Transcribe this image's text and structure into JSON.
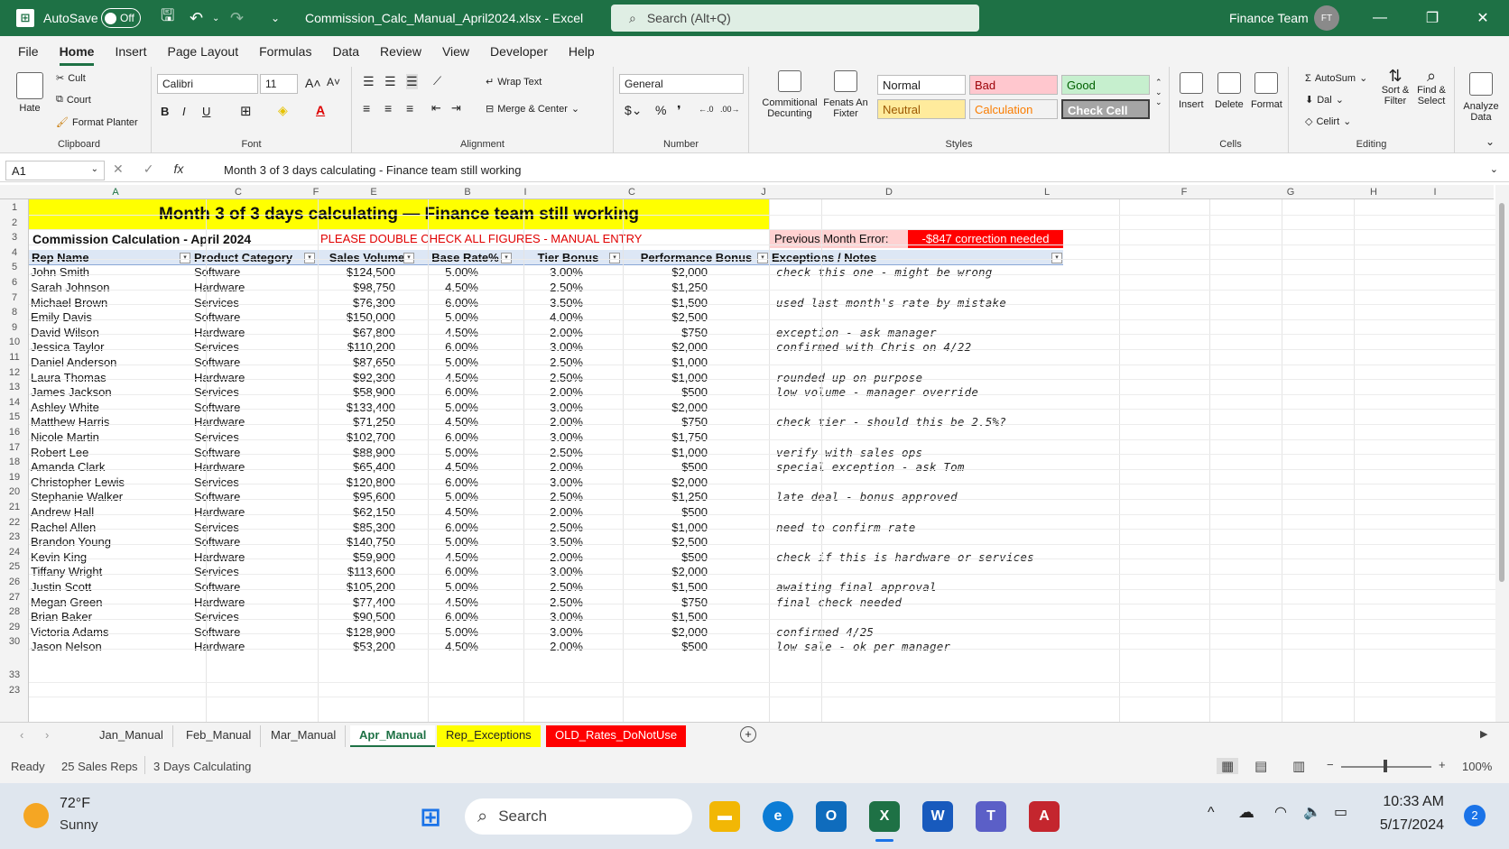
{
  "titlebar": {
    "autosave_label": "AutoSave",
    "autosave_state": "Off",
    "filename": "Commission_Calc_Manual_April2024.xlsx",
    "app": "Excel",
    "search_placeholder": "Search (Alt+Q)",
    "user": "Finance Team",
    "user_initials": "FT"
  },
  "menu": [
    "File",
    "Home",
    "Insert",
    "Page Layout",
    "Formulas",
    "Data",
    "Review",
    "View",
    "Developer",
    "Help"
  ],
  "ribbon": {
    "clipboard": {
      "paste": "Hate",
      "cut": "Cult",
      "copy": "Court",
      "format_painter": "Format Planter",
      "label": "Clipboard"
    },
    "font": {
      "name": "Calibri",
      "size": "11",
      "label": "Font"
    },
    "alignment": {
      "wrap": "Wrap Text",
      "merge": "Merge & Center",
      "label": "Alignment"
    },
    "number": {
      "format": "General",
      "label": "Number"
    },
    "styles": {
      "conditional": "Commitional Decunting",
      "format_as_table": "Fenats An Fixter",
      "normal": "Normal",
      "bad": "Bad",
      "good": "Good",
      "neutral": "Neutral",
      "calculation": "Calculation",
      "check_cell": "Check Cell",
      "label": "Styles"
    },
    "cells": {
      "insert": "Insert",
      "delete": "Delete",
      "format": "Format",
      "label": "Cells"
    },
    "editing": {
      "autosum": "AutoSum",
      "fill": "Dal",
      "clear": "Celirt",
      "sort": "Sort & Filter",
      "find": "Find & Select",
      "label": "Editing"
    },
    "analyze": "Analyze Data"
  },
  "formula_bar": {
    "name_box": "A1",
    "fx": "fx",
    "content": "Month 3 of 3 days calculating - Finance team still working"
  },
  "columns": [
    "A",
    "C",
    "F",
    "E",
    "B",
    "I",
    "C",
    "J",
    "I",
    "J",
    "D",
    "L",
    "F",
    "G",
    "H",
    "I"
  ],
  "sheet": {
    "banner": "Month 3 of 3 days calculating — Finance team still working",
    "subtitle": "Commission Calculation - April 2024",
    "warning": "PLEASE DOUBLE CHECK ALL FIGURES - MANUAL ENTRY",
    "prev_error_label": "Previous Month Error:",
    "prev_error_value": "-$847 correction needed",
    "headers": [
      "Rep Name",
      "Product Category",
      "Sales Volume",
      "Base Rate%",
      "Tier Bonus",
      "Performance Bonus",
      "Exceptions / Notes"
    ],
    "rows": [
      [
        "John Smith",
        "Software",
        "$124,500",
        "5.00%",
        "3.00%",
        "$2,000",
        "check this one - might be wrong"
      ],
      [
        "Sarah Johnson",
        "Hardware",
        "$98,750",
        "4.50%",
        "2.50%",
        "$1,250",
        ""
      ],
      [
        "Michael Brown",
        "Services",
        "$76,300",
        "6.00%",
        "3.50%",
        "$1,500",
        "used last month's rate by mistake"
      ],
      [
        "Emily Davis",
        "Software",
        "$150,000",
        "5.00%",
        "4.00%",
        "$2,500",
        ""
      ],
      [
        "David Wilson",
        "Hardware",
        "$67,800",
        "4.50%",
        "2.00%",
        "$750",
        "exception - ask manager"
      ],
      [
        "Jessica Taylor",
        "Services",
        "$110,200",
        "6.00%",
        "3.00%",
        "$2,000",
        "confirmed with Chris on 4/22"
      ],
      [
        "Daniel Anderson",
        "Software",
        "$87,650",
        "5.00%",
        "2.50%",
        "$1,000",
        ""
      ],
      [
        "Laura Thomas",
        "Hardware",
        "$92,300",
        "4.50%",
        "2.50%",
        "$1,000",
        "rounded up on purpose"
      ],
      [
        "James Jackson",
        "Services",
        "$58,900",
        "6.00%",
        "2.00%",
        "$500",
        "low volume - manager override"
      ],
      [
        "Ashley White",
        "Software",
        "$133,400",
        "5.00%",
        "3.00%",
        "$2,000",
        ""
      ],
      [
        "Matthew Harris",
        "Hardware",
        "$71,250",
        "4.50%",
        "2.00%",
        "$750",
        "check tier - should this be 2.5%?"
      ],
      [
        "Nicole Martin",
        "Services",
        "$102,700",
        "6.00%",
        "3.00%",
        "$1,750",
        ""
      ],
      [
        "Robert Lee",
        "Software",
        "$88,900",
        "5.00%",
        "2.50%",
        "$1,000",
        "verify with sales ops"
      ],
      [
        "Amanda Clark",
        "Hardware",
        "$65,400",
        "4.50%",
        "2.00%",
        "$500",
        "special exception - ask Tom"
      ],
      [
        "Christopher Lewis",
        "Services",
        "$120,800",
        "6.00%",
        "3.00%",
        "$2,000",
        ""
      ],
      [
        "Stephanie Walker",
        "Software",
        "$95,600",
        "5.00%",
        "2.50%",
        "$1,250",
        "late deal - bonus approved"
      ],
      [
        "Andrew Hall",
        "Hardware",
        "$62,150",
        "4.50%",
        "2.00%",
        "$500",
        ""
      ],
      [
        "Rachel Allen",
        "Services",
        "$85,300",
        "6.00%",
        "2.50%",
        "$1,000",
        "need to confirm rate"
      ],
      [
        "Brandon Young",
        "Software",
        "$140,750",
        "5.00%",
        "3.50%",
        "$2,500",
        ""
      ],
      [
        "Kevin King",
        "Hardware",
        "$59,900",
        "4.50%",
        "2.00%",
        "$500",
        "check if this is hardware or services"
      ],
      [
        "Tiffany Wright",
        "Services",
        "$113,600",
        "6.00%",
        "3.00%",
        "$2,000",
        ""
      ],
      [
        "Justin Scott",
        "Software",
        "$105,200",
        "5.00%",
        "2.50%",
        "$1,500",
        "awaiting final approval"
      ],
      [
        "Megan Green",
        "Hardware",
        "$77,400",
        "4.50%",
        "2.50%",
        "$750",
        "final check needed"
      ],
      [
        "Brian Baker",
        "Services",
        "$90,500",
        "6.00%",
        "3.00%",
        "$1,500",
        ""
      ],
      [
        "Victoria Adams",
        "Software",
        "$128,900",
        "5.00%",
        "3.00%",
        "$2,000",
        "confirmed 4/25"
      ],
      [
        "Jason Nelson",
        "Hardware",
        "$53,200",
        "4.50%",
        "2.00%",
        "$500",
        "low sale - ok per manager"
      ]
    ],
    "row_numbers": [
      "1",
      "2",
      "3",
      "4",
      "5",
      "6",
      "7",
      "8",
      "9",
      "10",
      "11",
      "12",
      "13",
      "14",
      "15",
      "16",
      "17",
      "18",
      "19",
      "20",
      "21",
      "22",
      "23",
      "24",
      "25",
      "26",
      "27",
      "28",
      "29",
      "30",
      "33",
      "23"
    ]
  },
  "tabs": [
    {
      "label": "Jan_Manual",
      "style": "normal"
    },
    {
      "label": "Feb_Manual",
      "style": "normal"
    },
    {
      "label": "Mar_Manual",
      "style": "normal"
    },
    {
      "label": "Apr_Manual",
      "style": "active"
    },
    {
      "label": "Rep_Exceptions",
      "style": "yellow"
    },
    {
      "label": "OLD_Rates_DoNotUse",
      "style": "red"
    }
  ],
  "status": {
    "ready": "Ready",
    "count": "25 Sales Reps",
    "calc": "3 Days Calculating",
    "zoom": "100%"
  },
  "taskbar": {
    "temp": "72°F",
    "weather": "Sunny",
    "search": "Search",
    "time": "10:33 AM",
    "date": "5/17/2024",
    "notifications": "2"
  },
  "colors": {
    "excel_green": "#1e7145",
    "banner_yellow": "#ffff00",
    "error_red": "#ff0000",
    "warning_text": "#e00000"
  }
}
